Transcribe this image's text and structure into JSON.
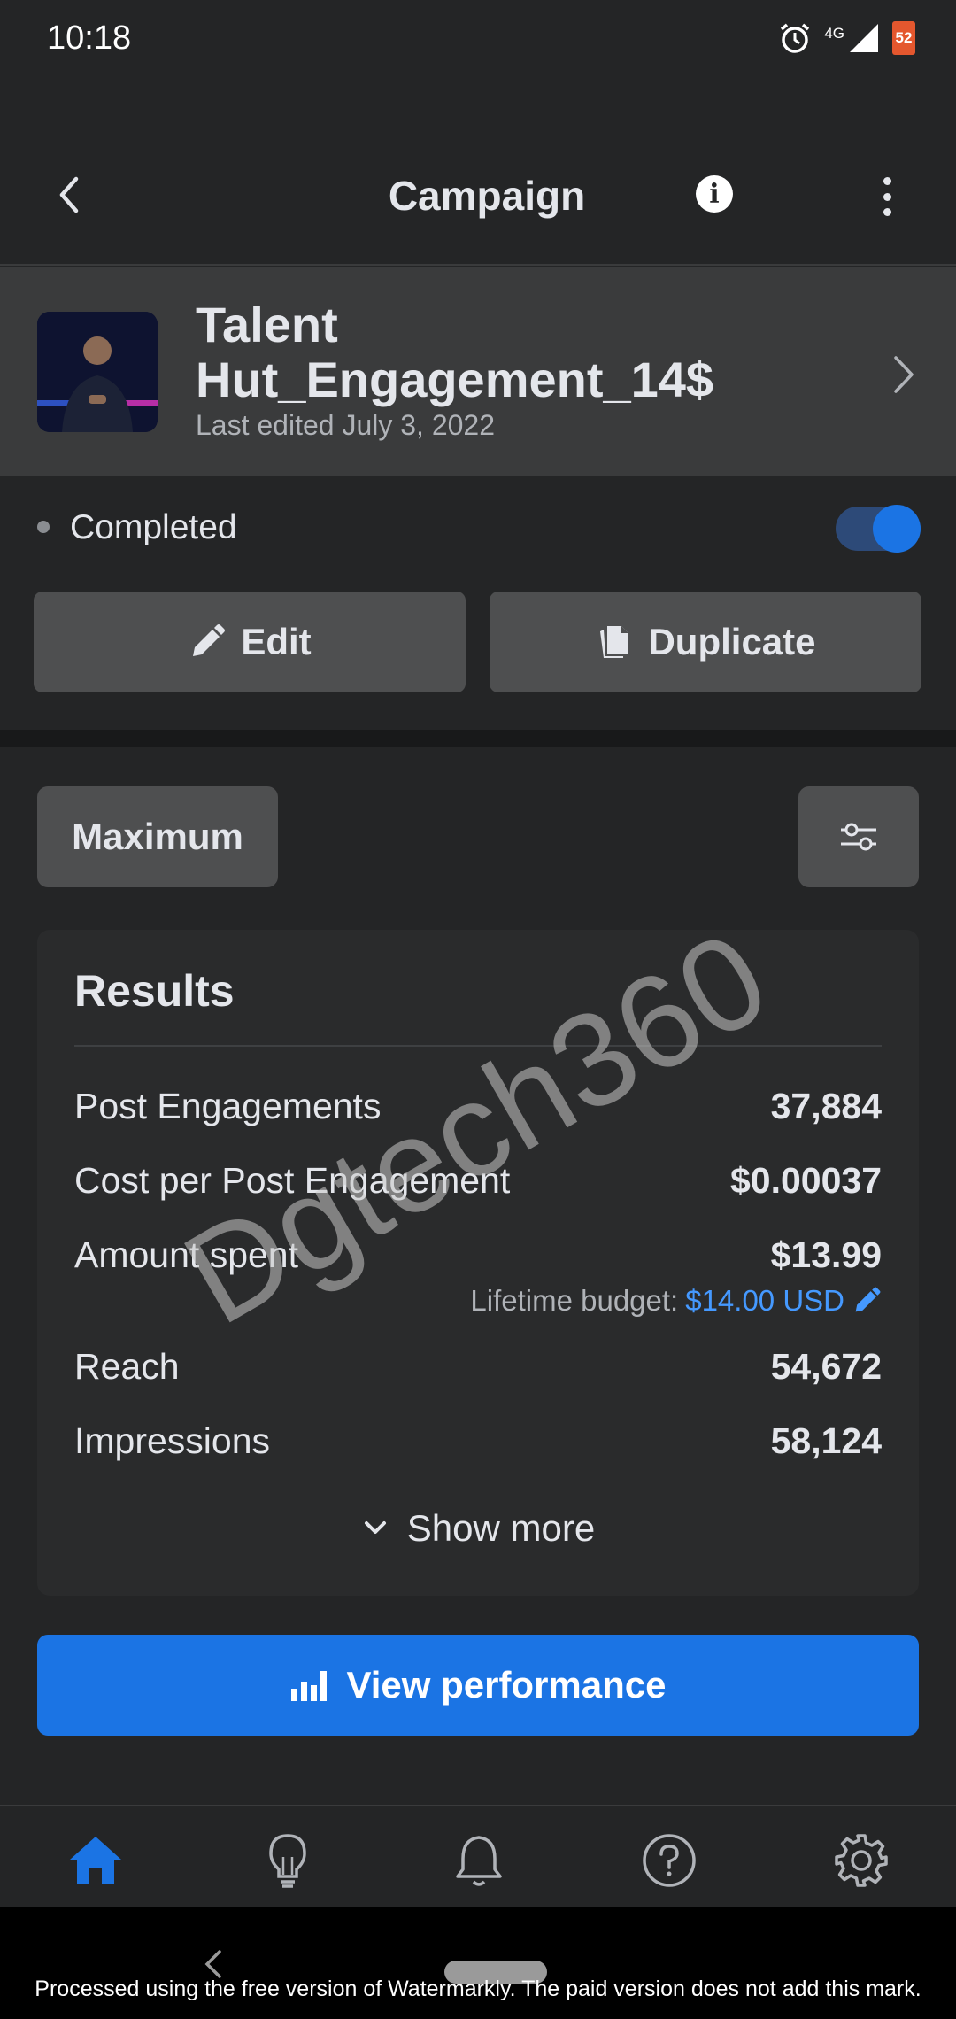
{
  "status_bar": {
    "time": "10:18",
    "network": "4G",
    "battery": "52",
    "icons": [
      "alarm-icon",
      "signal-icon",
      "battery-icon"
    ]
  },
  "top_bar": {
    "title": "Campaign",
    "info_label": "i",
    "icons": [
      "back-arrow-icon",
      "info-icon",
      "more-vertical-icon"
    ]
  },
  "campaign": {
    "name": "Talent Hut_Engagement_14$",
    "last_edited": "Last edited July 3, 2022",
    "status": "Completed",
    "toggle_on": true
  },
  "actions": {
    "edit_label": "Edit",
    "duplicate_label": "Duplicate"
  },
  "filters": {
    "range_label": "Maximum"
  },
  "results": {
    "title": "Results",
    "metrics": [
      {
        "label": "Post Engagements",
        "value": "37,884"
      },
      {
        "label": "Cost per Post Engagement",
        "value": "$0.00037"
      },
      {
        "label": "Amount spent",
        "value": "$13.99"
      },
      {
        "label": "Reach",
        "value": "54,672"
      },
      {
        "label": "Impressions",
        "value": "58,124"
      }
    ],
    "budget_label": "Lifetime budget:",
    "budget_value": "$14.00 USD",
    "show_more": "Show more"
  },
  "view_performance": "View performance",
  "watermark": "Dgtech360",
  "bottom_nav": [
    "home-icon",
    "lightbulb-icon",
    "bell-icon",
    "help-icon",
    "settings-icon"
  ],
  "system_bar": {
    "note": "Processed using the free version of Watermarkly. The paid version does not add this mark."
  },
  "colors": {
    "background": "#242526",
    "surface": "#3a3b3c",
    "button": "#4e4f50",
    "accent": "#1b74e4",
    "link": "#4599ff"
  }
}
